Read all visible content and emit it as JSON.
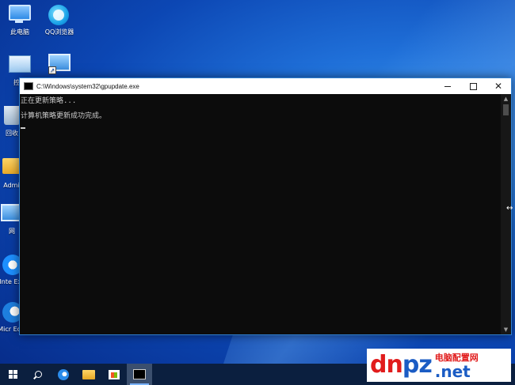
{
  "desktop": {
    "icons": [
      {
        "label": "此电脑",
        "icon": "computer-icon"
      },
      {
        "label": "QQ浏览器",
        "icon": "qq-browser-icon"
      },
      {
        "label": "控制",
        "icon": "control-panel-icon"
      },
      {
        "label": "",
        "icon": "network-icon"
      },
      {
        "label": "回收",
        "icon": "recycle-bin-icon"
      },
      {
        "label": "Admin",
        "icon": "folder-icon"
      },
      {
        "label": "网",
        "icon": "network-icon"
      },
      {
        "label": "Inte Expl",
        "icon": "internet-explorer-icon"
      },
      {
        "label": "Micr Edge",
        "icon": "edge-icon"
      }
    ]
  },
  "console": {
    "title": "C:\\Windows\\system32\\gpupdate.exe",
    "lines": [
      "正在更新策略...",
      "",
      "计算机策略更新成功完成。"
    ]
  },
  "taskbar": {
    "items": [
      "start-icon",
      "search-icon",
      "edge-icon",
      "file-explorer-icon",
      "store-icon",
      "cmd-icon"
    ]
  },
  "watermark": {
    "logo_text_a": "dn",
    "logo_text_b": "pz",
    "cn_text": "电脑配置网",
    "net_text": ".net"
  },
  "colors": {
    "console_bg": "#0c0c0c",
    "console_text": "#cccccc",
    "accent": "#2f7fd0",
    "taskbar": "#0b1f3f"
  }
}
